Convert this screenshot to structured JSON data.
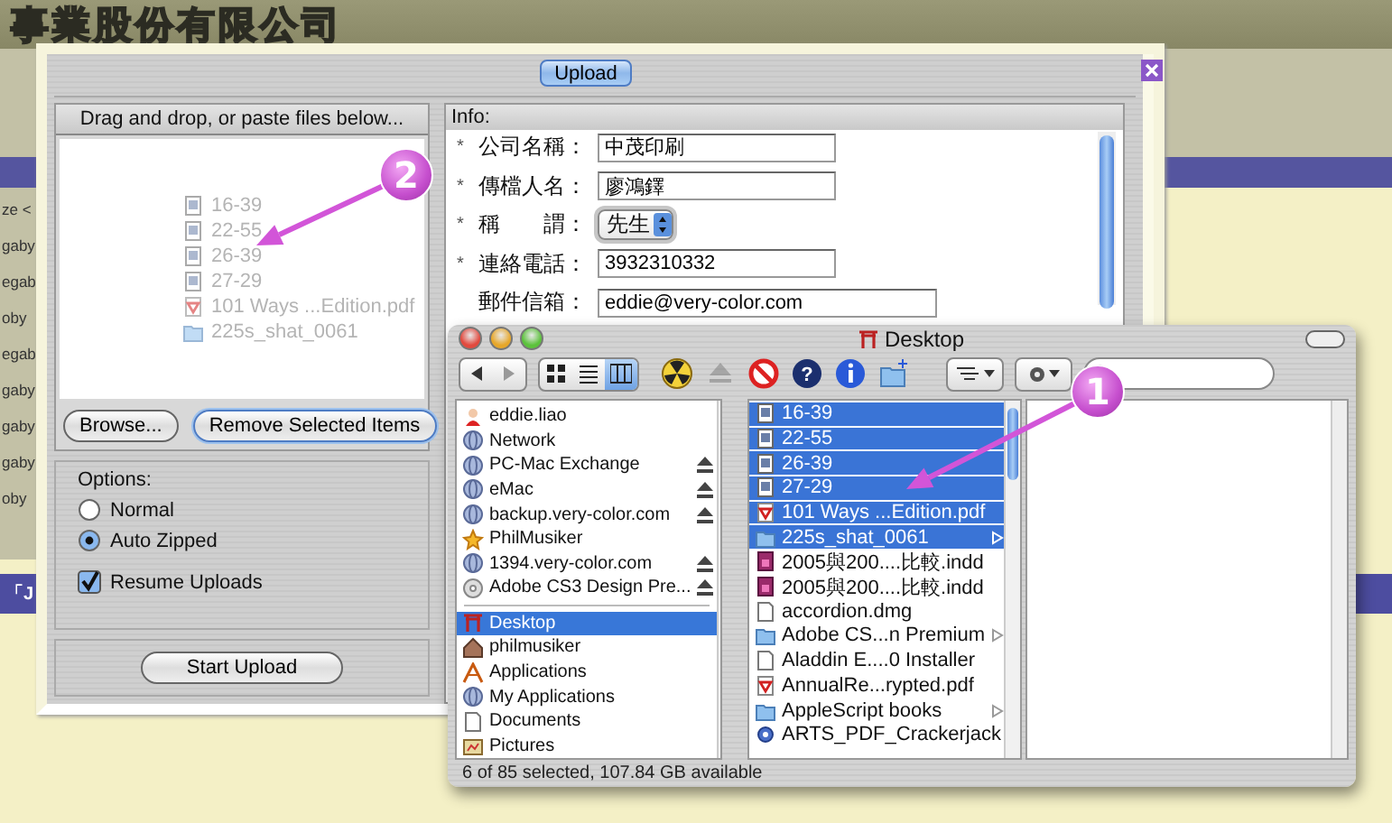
{
  "background": {
    "banner_text": "事業股份有限公司",
    "side_fragments": [
      "ze <",
      "gaby",
      "egab",
      "oby",
      "egab",
      "gaby",
      "gaby",
      "gaby",
      "oby"
    ],
    "bottom_fragment": "「J"
  },
  "upload_window": {
    "tab": "Upload",
    "drop_area": {
      "header": "Drag and drop, or paste files below...",
      "files": [
        {
          "name": "16-39",
          "kind": "image"
        },
        {
          "name": "22-55",
          "kind": "image"
        },
        {
          "name": "26-39",
          "kind": "image"
        },
        {
          "name": "27-29",
          "kind": "image"
        },
        {
          "name": "101 Ways ...Edition.pdf",
          "kind": "pdf"
        },
        {
          "name": "225s_shat_0061",
          "kind": "folder"
        }
      ]
    },
    "buttons": [
      "Browse...",
      "Remove Selected Items"
    ],
    "options": {
      "title": "Options:",
      "radios": [
        {
          "label": "Normal",
          "selected": false
        },
        {
          "label": "Auto Zipped",
          "selected": true
        }
      ],
      "checkbox": {
        "label": "Resume Uploads",
        "checked": true
      }
    },
    "start_button": "Start Upload",
    "info": {
      "header": "Info:",
      "fields": [
        {
          "mark": "*",
          "label": "公司名稱：",
          "value": "中茂印刷",
          "kind": "text"
        },
        {
          "mark": "*",
          "label": "傳檔人名：",
          "value": "廖鴻鐸",
          "kind": "text"
        },
        {
          "mark": "*",
          "label": "稱　　謂：",
          "value": "先生",
          "kind": "select"
        },
        {
          "mark": "*",
          "label": "連絡電話：",
          "value": "3932310332",
          "kind": "text"
        },
        {
          "label": "郵件信箱：",
          "value": "eddie@very-color.com",
          "kind": "wide"
        }
      ]
    }
  },
  "finder": {
    "title": "Desktop",
    "view_modes": [
      {
        "kind": "icons",
        "selected": false
      },
      {
        "kind": "list",
        "selected": false
      },
      {
        "kind": "columns",
        "selected": true
      }
    ],
    "tools": [
      {
        "kind": "radiation",
        "disabled": false
      },
      {
        "kind": "eject",
        "disabled": true
      },
      {
        "kind": "stop",
        "disabled": false
      },
      {
        "kind": "help",
        "disabled": false,
        "label": "?"
      },
      {
        "kind": "info",
        "disabled": false
      },
      {
        "kind": "newfolder",
        "disabled": false
      }
    ],
    "devices": [
      {
        "name": "eddie.liao",
        "kind": "user",
        "eject": false
      },
      {
        "name": "Network",
        "kind": "globe",
        "eject": false
      },
      {
        "name": "PC-Mac Exchange",
        "kind": "globe",
        "eject": true
      },
      {
        "name": "eMac",
        "kind": "globe",
        "eject": true
      },
      {
        "name": "backup.very-color.com",
        "kind": "globe",
        "eject": true
      },
      {
        "name": "PhilMusiker",
        "kind": "star",
        "eject": false
      },
      {
        "name": "1394.very-color.com",
        "kind": "globe",
        "eject": true
      },
      {
        "name": "Adobe CS3 Design Pre...",
        "kind": "disc",
        "eject": true
      }
    ],
    "places": [
      {
        "name": "Desktop",
        "kind": "gate",
        "selected": true
      },
      {
        "name": "philmusiker",
        "kind": "house",
        "selected": false
      },
      {
        "name": "Applications",
        "kind": "apps",
        "selected": false
      },
      {
        "name": "My Applications",
        "kind": "globe",
        "selected": false
      },
      {
        "name": "Documents",
        "kind": "doc",
        "selected": false
      },
      {
        "name": "Pictures",
        "kind": "picture",
        "selected": false
      }
    ],
    "items": [
      {
        "name": "16-39",
        "kind": "image",
        "selected": true,
        "expandable": false
      },
      {
        "name": "22-55",
        "kind": "image",
        "selected": true,
        "expandable": false
      },
      {
        "name": "26-39",
        "kind": "image",
        "selected": true,
        "expandable": false
      },
      {
        "name": "27-29",
        "kind": "image",
        "selected": true,
        "expandable": false
      },
      {
        "name": "101 Ways ...Edition.pdf",
        "kind": "pdf",
        "selected": true,
        "expandable": false
      },
      {
        "name": "225s_shat_0061",
        "kind": "folder",
        "selected": true,
        "expandable": true
      },
      {
        "name": "2005與200....比較.indd",
        "kind": "indd",
        "selected": false,
        "expandable": false
      },
      {
        "name": "2005與200....比較.indd",
        "kind": "indd",
        "selected": false,
        "expandable": false
      },
      {
        "name": "accordion.dmg",
        "kind": "doc",
        "selected": false,
        "expandable": false
      },
      {
        "name": "Adobe CS...n Premium",
        "kind": "folder",
        "selected": false,
        "expandable": true
      },
      {
        "name": "Aladdin E....0 Installer",
        "kind": "doc",
        "selected": false,
        "expandable": false
      },
      {
        "name": "AnnualRe...rypted.pdf",
        "kind": "pdf",
        "selected": false,
        "expandable": false
      },
      {
        "name": "AppleScript books",
        "kind": "folder",
        "selected": false,
        "expandable": true
      },
      {
        "name": "ARTS_PDF_Crackerjack",
        "kind": "gear",
        "selected": false,
        "expandable": false
      }
    ],
    "status": "6 of 85 selected, 107.84 GB available"
  },
  "callouts": [
    {
      "label": "1"
    },
    {
      "label": "2"
    }
  ]
}
